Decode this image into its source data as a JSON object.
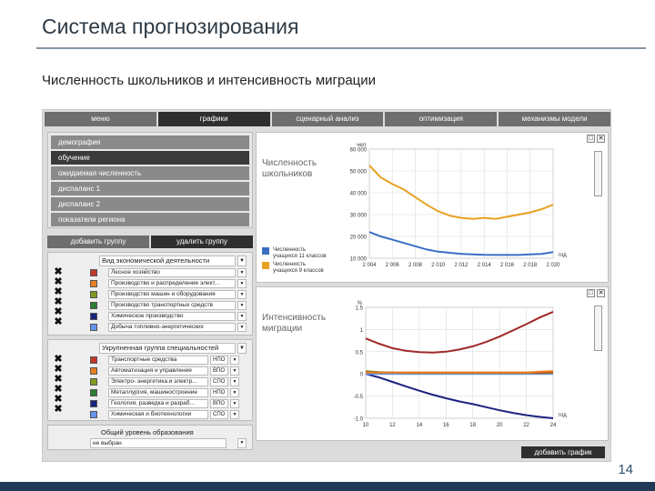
{
  "slide": {
    "title": "Система прогнозирования",
    "subtitle": "Численность школьников и интенсивность миграции",
    "page_number": "14"
  },
  "nav": {
    "tabs": [
      {
        "label": "меню",
        "active": false
      },
      {
        "label": "графики",
        "active": true
      },
      {
        "label": "сценарный анализ",
        "active": false
      },
      {
        "label": "оптимизация",
        "active": false
      },
      {
        "label": "механизмы модели",
        "active": false
      }
    ]
  },
  "categories": [
    {
      "label": "демография",
      "active": false
    },
    {
      "label": "обучение",
      "active": true
    },
    {
      "label": "ожидаемая численность",
      "active": false
    },
    {
      "label": "диспаланс 1",
      "active": false
    },
    {
      "label": "диспаланс 2",
      "active": false
    },
    {
      "label": "показатели региона",
      "active": false
    }
  ],
  "group_buttons": {
    "add": "добавить группу",
    "remove": "удалить группу"
  },
  "group1": {
    "header": "Вид экономической деятельности",
    "rows": [
      {
        "label": "Лесное хозяйство",
        "color": "#c0392b"
      },
      {
        "label": "Производство и распределение элект...",
        "color": "#e67e22"
      },
      {
        "label": "Производство машин и оборудования",
        "color": "#7f9a1f"
      },
      {
        "label": "Производство транспортных средств",
        "color": "#2e7d32"
      },
      {
        "label": "Химическое производство",
        "color": "#1a237e"
      },
      {
        "label": "Добыча топливно-энергетических",
        "color": "#6495ed"
      }
    ]
  },
  "group2": {
    "header": "Укрупненная группа специальностей",
    "rows": [
      {
        "label": "Транспортные средства",
        "unit": "НПО",
        "color": "#c0392b"
      },
      {
        "label": "Автоматизация и управление",
        "unit": "ВПО",
        "color": "#e67e22"
      },
      {
        "label": "Электро- энергетика и электр...",
        "unit": "СПО",
        "color": "#7f9a1f"
      },
      {
        "label": "Металлургия, машиностроение",
        "unit": "НПО",
        "color": "#2e7d32"
      },
      {
        "label": "Геология, разведка и разраб...",
        "unit": "ВПО",
        "color": "#1a237e"
      },
      {
        "label": "Химическая и биотехнологии",
        "unit": "СПО",
        "color": "#6495ed"
      }
    ]
  },
  "group3": {
    "header": "Общий уровень образования",
    "select_value": "не выбран"
  },
  "add_chart_button": "добавить график",
  "chart_top": {
    "title": "Численность школьников",
    "legend": [
      {
        "name": "Численность учащихся 11 классов",
        "color": "#3a6fc4"
      },
      {
        "name": "Численность учащихся 9 классов",
        "color": "#e8a020"
      }
    ],
    "y_unit": "чел",
    "x_unit": "год"
  },
  "chart_bottom": {
    "title": "Интенсивность миграции",
    "y_unit": "%",
    "x_unit": "год"
  },
  "chart_data": [
    {
      "type": "line",
      "title": "Численность школьников",
      "xlabel": "год",
      "ylabel": "чел",
      "x": [
        2004,
        2005,
        2006,
        2007,
        2008,
        2009,
        2010,
        2011,
        2012,
        2013,
        2014,
        2015,
        2016,
        2017,
        2018,
        2019,
        2020
      ],
      "xticks": [
        "2 004",
        "2 006",
        "2 008",
        "2 010",
        "2 012",
        "2 014",
        "2 016",
        "2 018",
        "2 020"
      ],
      "yticks": [
        "10 000",
        "20 000",
        "30 000",
        "40 000",
        "50 000",
        "60 000"
      ],
      "ylim": [
        10000,
        60000
      ],
      "xlim": [
        2004,
        2020
      ],
      "series": [
        {
          "name": "Численность учащихся 9 классов",
          "color": "#e8a020",
          "values": [
            52500,
            47000,
            44000,
            41500,
            38000,
            34500,
            31500,
            29500,
            28500,
            28000,
            28500,
            28000,
            29000,
            30000,
            31000,
            32500,
            34500
          ]
        },
        {
          "name": "Численность учащихся 11 классов",
          "color": "#3a6fc4",
          "values": [
            22000,
            20000,
            18500,
            17000,
            15500,
            14000,
            13000,
            12500,
            12000,
            11800,
            11600,
            11500,
            11500,
            11500,
            11800,
            12000,
            12800
          ]
        }
      ]
    },
    {
      "type": "line",
      "title": "Интенсивность миграции",
      "xlabel": "год",
      "ylabel": "%",
      "x": [
        10,
        11,
        12,
        13,
        14,
        15,
        16,
        17,
        18,
        19,
        20,
        21,
        22,
        23,
        24
      ],
      "xticks": [
        "10",
        "12",
        "14",
        "16",
        "18",
        "20",
        "22",
        "24"
      ],
      "yticks": [
        "-1.0",
        "-0.5",
        "0",
        "0.5",
        "1",
        "1.5"
      ],
      "ylim": [
        -1.0,
        1.5
      ],
      "xlim": [
        10,
        24
      ],
      "series": [
        {
          "color": "#a02828",
          "values": [
            0.8,
            0.68,
            0.58,
            0.52,
            0.49,
            0.48,
            0.5,
            0.55,
            0.62,
            0.72,
            0.84,
            0.98,
            1.12,
            1.27,
            1.4
          ]
        },
        {
          "color": "#1a237e",
          "values": [
            0.0,
            -0.08,
            -0.18,
            -0.28,
            -0.38,
            -0.47,
            -0.55,
            -0.62,
            -0.68,
            -0.75,
            -0.82,
            -0.88,
            -0.93,
            -0.97,
            -1.0
          ]
        },
        {
          "color": "#6495ed",
          "values": [
            0.0,
            0.0,
            0.0,
            0.0,
            0.0,
            0.0,
            0.0,
            0.0,
            0.0,
            0.0,
            0.0,
            0.0,
            0.0,
            0.0,
            0.0
          ]
        },
        {
          "color": "#7f9a1f",
          "values": [
            0.06,
            0.04,
            0.03,
            0.02,
            0.02,
            0.02,
            0.02,
            0.02,
            0.02,
            0.02,
            0.02,
            0.02,
            0.02,
            0.02,
            0.02
          ]
        },
        {
          "color": "#c0392b",
          "values": [
            0.04,
            0.03,
            0.03,
            0.03,
            0.03,
            0.03,
            0.03,
            0.03,
            0.03,
            0.03,
            0.03,
            0.03,
            0.03,
            0.03,
            0.04
          ]
        },
        {
          "color": "#e67e22",
          "values": [
            0.03,
            0.03,
            0.03,
            0.03,
            0.03,
            0.03,
            0.03,
            0.03,
            0.03,
            0.03,
            0.03,
            0.03,
            0.03,
            0.05,
            0.06
          ]
        }
      ]
    }
  ]
}
